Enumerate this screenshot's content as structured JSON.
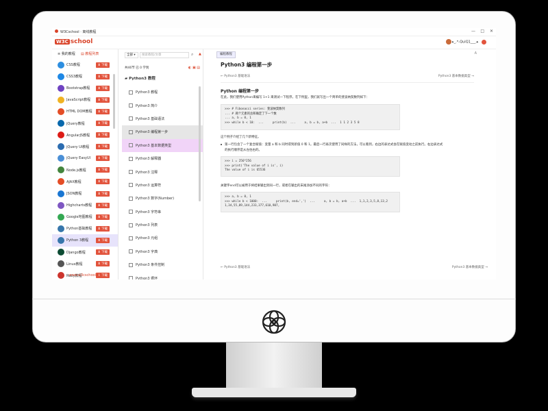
{
  "window": {
    "title": "W3Cschool · 离线教程",
    "controls": [
      "—",
      "□",
      "✕"
    ]
  },
  "brand": {
    "badge": "W3C",
    "name": "school"
  },
  "user": {
    "name": "▸_.*-QuiQ1___.▸"
  },
  "sidebar": {
    "tabs": [
      {
        "label": "≡ 我的教程"
      },
      {
        "label": "▤ 教程列表"
      }
    ],
    "download_label": "⬇ 下载",
    "items": [
      {
        "label": "CSS教程",
        "color": "#2d8ee0"
      },
      {
        "label": "CSS3教程",
        "color": "#1e88e5"
      },
      {
        "label": "Bootstrap教程",
        "color": "#6f42c1"
      },
      {
        "label": "JavaScript教程",
        "color": "#f0b323"
      },
      {
        "label": "HTML DOM教程",
        "color": "#e44d26"
      },
      {
        "label": "jQuery教程",
        "color": "#0868ac"
      },
      {
        "label": "AngularJS教程",
        "color": "#dd1b16"
      },
      {
        "label": "jQuery UI教程",
        "color": "#2b6cb0"
      },
      {
        "label": "jQuery EasyUI",
        "color": "#4a8fd6"
      },
      {
        "label": "Node.js教程",
        "color": "#43853d"
      },
      {
        "label": "AJAX教程",
        "color": "#e44d26"
      },
      {
        "label": "JSON教程",
        "color": "#1976d2"
      },
      {
        "label": "Highcharts教程",
        "color": "#7e57c2"
      },
      {
        "label": "Google地图教程",
        "color": "#34a853"
      },
      {
        "label": "Python基础教程",
        "color": "#3776ab"
      },
      {
        "label": "Python 3教程",
        "color": "#3776ab"
      },
      {
        "label": "Django教程",
        "color": "#0c4b33"
      },
      {
        "label": "Linux教程",
        "color": "#555555"
      },
      {
        "label": "Ruby教程",
        "color": "#cc342d"
      }
    ],
    "active_index": 15,
    "footer": "www.w3cschool.cn"
  },
  "middle": {
    "search": {
      "scope": "全部",
      "placeholder": "搜索教程/文章"
    },
    "meta": "共46节  已 0 学到",
    "tools": "◐  ▣  ▤",
    "heading": "Python3 教程",
    "items": [
      "Python3 教程",
      "Python3 简介",
      "Python3 基础语法",
      "Python3 编程第一步",
      "Python3 基本数据类型",
      "Python3 解释器",
      "Python3 注释",
      "Python3 运算符",
      "Python3 数字(Number)",
      "Python3 字符串",
      "Python3 列表",
      "Python3 元组",
      "Python3 字典",
      "Python3 条件控制",
      "Python3 循环"
    ],
    "selected_index": 3,
    "highlight_index": 4
  },
  "content": {
    "tab": "编程教程",
    "title": "Python3 编程第一步",
    "prev": "← Python3 基础语法",
    "next": "Python3 基本数据类型 →",
    "h2": "Python 编程第一步",
    "p1": "在此，我们使用Python来编写 1+1 来测试一下程序。在下例里，我们就写出一个简单的斐波纳契数列如下：",
    "code1": ">>> # Fibonacci series: 斐波纳契数列\n... # 两个元素的总和确定了下一个数\n... a, b = 0, 1\n>>> while b < 10:  ...     print(b)  ...     a, b = b, a+b  ...  1 1 2 3 5 8",
    "p2": "这个例子介绍了几个新特征。",
    "p3": "第一行包含了一个复合赋值：变量 a 和 b 同时得到新值 0 和 1。最后一行再次使用了同样的方法，可以看到，右边的表达式会在赋值变动之前执行。右边表达式",
    "p4": "的执行顺序是从左往右的。",
    "code2": ">>> i = 256*256\n>>> print('The value of i is', i)\nThe value of i is 65536",
    "p5": "关键字end可以被用于将结果输出到同一行，或者在输出的末尾添加不同的字符：",
    "code3": ">>> a, b = 0, 1\n>>> while b < 1000:  ...     print(b, end=',')  ...     a, b = b, a+b  ...  1,1,2,3,5,8,13,2\n1,34,55,89,144,233,377,610,987,"
  }
}
